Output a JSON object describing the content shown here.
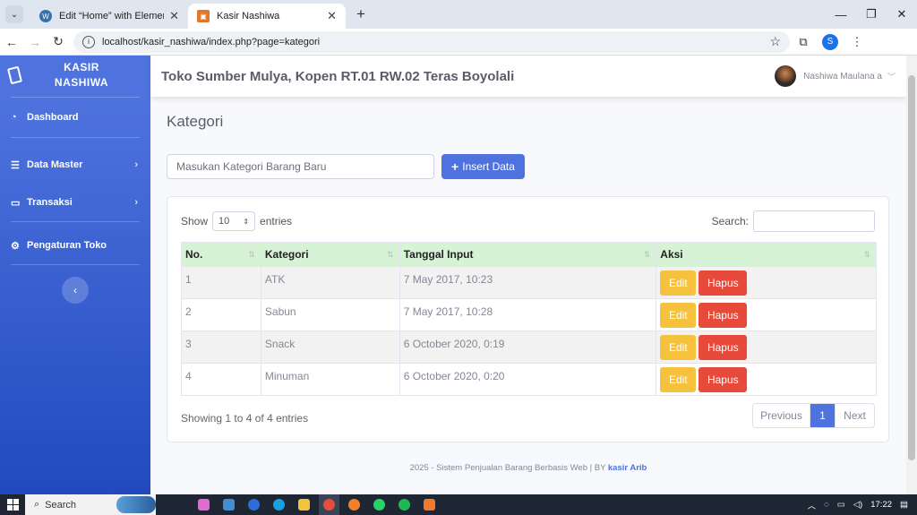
{
  "browser": {
    "tabs": [
      {
        "label": "Edit “Home” with Elementor",
        "favicon_color": "#3a6fb0",
        "favicon_glyph": "W"
      },
      {
        "label": "Kasir Nashiwa",
        "favicon_color": "#e0772a",
        "favicon_glyph": "▣"
      }
    ],
    "url": "localhost/kasir_nashiwa/index.php?page=kategori",
    "profile_initial": "S"
  },
  "sidebar": {
    "brand_line1": "KASIR",
    "brand_line2": "NASHIWA",
    "items": [
      {
        "label": "Dashboard",
        "icon": "◔"
      },
      {
        "label": "Data Master",
        "icon": "☰"
      },
      {
        "label": "Transaksi",
        "icon": "▭"
      },
      {
        "label": "Pengaturan Toko",
        "icon": "⚙"
      }
    ],
    "toggle_icon": "‹"
  },
  "topbar": {
    "store_name": "Toko Sumber Mulya, Kopen RT.01 RW.02 Teras Boyolali",
    "user_name": "Nashiwa Maulana a"
  },
  "page": {
    "title": "Kategori",
    "input_placeholder": "Masukan Kategori Barang Baru",
    "insert_label": "Insert Data"
  },
  "table": {
    "show_label": "Show",
    "entries_label": "entries",
    "page_length": "10",
    "search_label": "Search:",
    "headers": [
      "No.",
      "Kategori",
      "Tanggal Input",
      "Aksi"
    ],
    "rows": [
      {
        "no": "1",
        "kategori": "ATK",
        "tanggal": "7 May 2017, 10:23"
      },
      {
        "no": "2",
        "kategori": "Sabun",
        "tanggal": "7 May 2017, 10:28"
      },
      {
        "no": "3",
        "kategori": "Snack",
        "tanggal": "6 October 2020, 0:19"
      },
      {
        "no": "4",
        "kategori": "Minuman",
        "tanggal": "6 October 2020, 0:20"
      }
    ],
    "edit_label": "Edit",
    "hapus_label": "Hapus",
    "info": "Showing 1 to 4 of 4 entries",
    "pager": {
      "previous": "Previous",
      "current": "1",
      "next": "Next"
    }
  },
  "footer": {
    "text": "2025 - Sistem Penjualan Barang Berbasis Web | BY ",
    "brand": "kasir Arib"
  },
  "taskbar": {
    "search_label": "Search",
    "time": "17:22",
    "apps": [
      {
        "name": "copilot",
        "color": "#e36ad3"
      },
      {
        "name": "photos",
        "color": "#3f8fd6"
      },
      {
        "name": "chrome-alt",
        "color": "#2b6fd6"
      },
      {
        "name": "edge",
        "color": "#1aa0e0"
      },
      {
        "name": "explorer",
        "color": "#f3c33d"
      },
      {
        "name": "chrome",
        "color": "#e84c3d"
      },
      {
        "name": "firefox",
        "color": "#f2812a"
      },
      {
        "name": "whatsapp",
        "color": "#25d366"
      },
      {
        "name": "spotify",
        "color": "#1db954"
      },
      {
        "name": "xampp",
        "color": "#f07a2c"
      }
    ]
  }
}
